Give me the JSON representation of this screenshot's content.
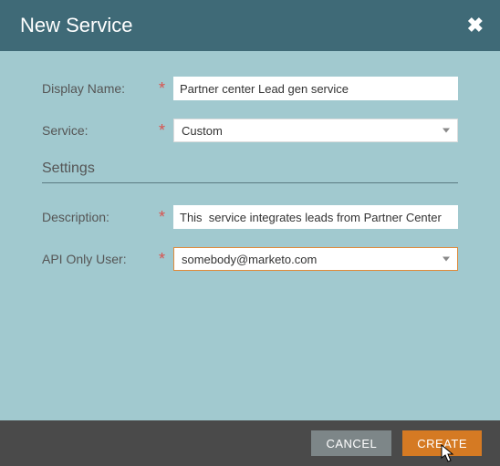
{
  "header": {
    "title": "New Service"
  },
  "form": {
    "display_name": {
      "label": "Display Name:",
      "value": "Partner center Lead gen service"
    },
    "service": {
      "label": "Service:",
      "value": "Custom"
    },
    "settings_heading": "Settings",
    "description": {
      "label": "Description:",
      "value": "This  service integrates leads from Partner Center"
    },
    "api_only_user": {
      "label": "API Only User:",
      "value": "somebody@marketo.com"
    }
  },
  "footer": {
    "cancel": "CANCEL",
    "create": "CREATE"
  },
  "required_mark": "*"
}
